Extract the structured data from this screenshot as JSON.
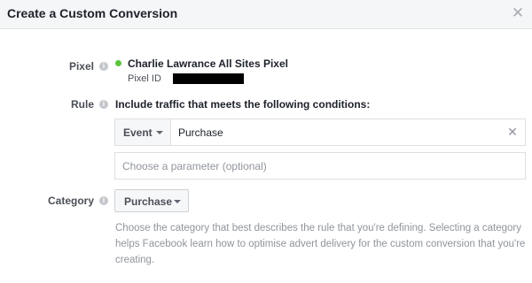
{
  "dialog": {
    "title": "Create a Custom Conversion",
    "close_icon": "close-icon"
  },
  "pixel": {
    "label": "Pixel",
    "status_color": "#5ac43a",
    "name": "Charlie Lawrance All Sites Pixel",
    "id_label": "Pixel ID"
  },
  "rule": {
    "label": "Rule",
    "description": "Include traffic that meets the following conditions:",
    "condition": {
      "type_selected": "Event",
      "value": "Purchase"
    },
    "parameter_placeholder": "Choose a parameter (optional)"
  },
  "category": {
    "label": "Category",
    "selected": "Purchase",
    "help_lines": [
      "Choose the category that best describes the rule that you're defining. Selecting a category",
      "helps Facebook learn how to optimise advert delivery for the custom conversion that you're",
      "creating."
    ]
  },
  "icons": {
    "info": "info-icon",
    "dropdown": "caret-down-icon",
    "clear": "clear-icon"
  }
}
